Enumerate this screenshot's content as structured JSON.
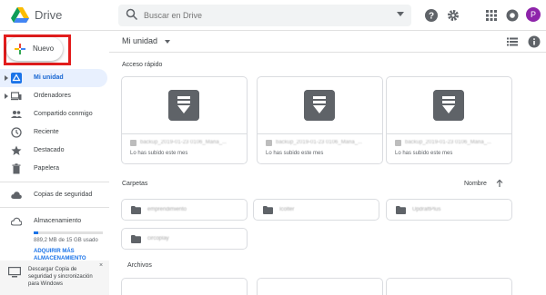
{
  "header": {
    "brand": "Drive",
    "search_placeholder": "Buscar en Drive",
    "avatar_initial": "P"
  },
  "sidebar": {
    "new_label": "Nuevo",
    "items": [
      {
        "label": "Mi unidad",
        "icon": "drive-icon",
        "active": true
      },
      {
        "label": "Ordenadores",
        "icon": "computers-icon"
      },
      {
        "label": "Compartido conmigo",
        "icon": "people-icon"
      },
      {
        "label": "Reciente",
        "icon": "clock-icon"
      },
      {
        "label": "Destacado",
        "icon": "star-icon"
      },
      {
        "label": "Papelera",
        "icon": "trash-icon"
      },
      {
        "label": "Copias de seguridad",
        "icon": "cloud-icon"
      },
      {
        "label": "Almacenamiento",
        "icon": "cloud-outline-icon"
      }
    ],
    "storage_used_fraction": 0.06,
    "storage_text": "889,2 MB de 15 GB usado",
    "buy_storage": "ADQUIRIR MÁS ALMACENAMIENTO",
    "promo_text": "Descargar Copia de seguridad y sincronización para Windows",
    "promo_close": "×"
  },
  "main": {
    "title": "Mi unidad",
    "quick_access_label": "Acceso rápido",
    "quick_access": [
      {
        "name": "backup_2019-01-23 0106_Maria_...",
        "sub": "Lo has subido este mes"
      },
      {
        "name": "backup_2019-01-23 0106_Maria_...",
        "sub": "Lo has subido este mes"
      },
      {
        "name": "backup_2019-01-23 0106_Maria_...",
        "sub": "Lo has subido este mes"
      }
    ],
    "folders_label": "Carpetas",
    "sort_label": "Nombre",
    "folders": [
      {
        "name": "emprendimiento"
      },
      {
        "name": "Icolter"
      },
      {
        "name": "UpdraftPlus"
      },
      {
        "name": "circoplay"
      }
    ],
    "files_label": "Archivos"
  },
  "colors": {
    "accent": "#1a73e8",
    "active_bg": "#e8f0fe",
    "highlight": "#e21d1d"
  }
}
